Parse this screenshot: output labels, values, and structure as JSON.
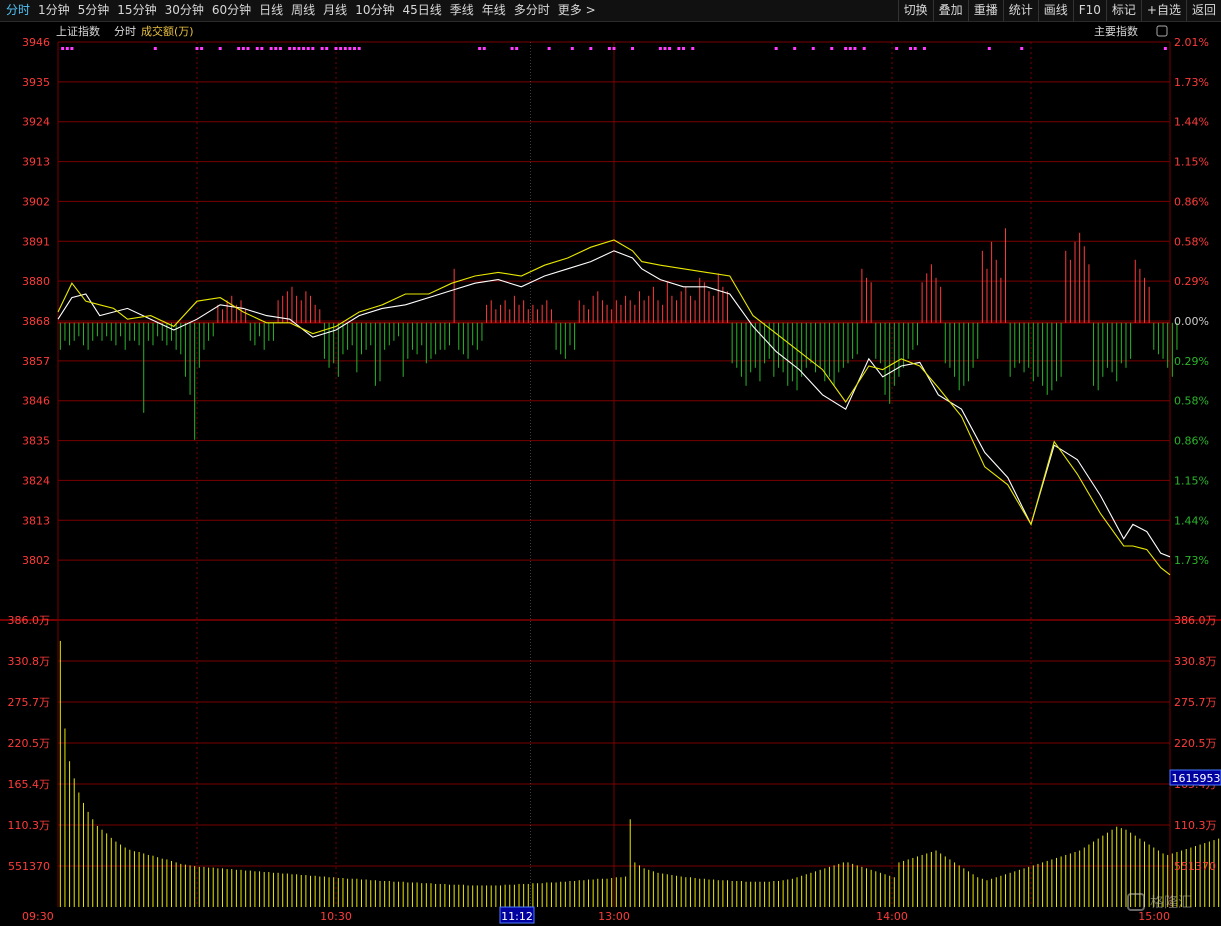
{
  "toolbar": {
    "left_items": [
      "分时",
      "1分钟",
      "5分钟",
      "15分钟",
      "30分钟",
      "60分钟",
      "日线",
      "周线",
      "月线",
      "10分钟",
      "45日线",
      "季线",
      "年线",
      "多分时",
      "更多 >"
    ],
    "active": "分时",
    "right_items": [
      "切换",
      "叠加",
      "重播",
      "统计",
      "画线",
      "F10",
      "标记",
      "+自选",
      "返回"
    ]
  },
  "header": {
    "index_name": "上证指数",
    "mode_label": "分时",
    "indicator_label": "成交额(万)",
    "right_label": "主要指数"
  },
  "colors": {
    "grid_red": "#7a0000",
    "up": "#ff3b3b",
    "down": "#2bb52b",
    "price_line": "#ffffff",
    "avg_line": "#e8e800",
    "marker": "#ff3cff",
    "axis_text_left": "#ff3b3b",
    "axis_text_vol": "#ff3b3b",
    "time_text": "#ff3b3b",
    "cursor_box": "#0000a0"
  },
  "cursor": {
    "time_label": "11:12",
    "volume_label": "1615953"
  },
  "watermark": "格隆汇",
  "chart_data": [
    {
      "type": "line",
      "title": "",
      "x_ticks": [
        "09:30",
        "10:30",
        "13:00",
        "14:00",
        "15:00"
      ],
      "y_ticks_left": [
        "3946",
        "3935",
        "3924",
        "3913",
        "3902",
        "3891",
        "3880",
        "3868",
        "3857",
        "3846",
        "3835",
        "3824",
        "3813",
        "3802"
      ],
      "y_ticks_right": [
        "2.01%",
        "1.73%",
        "1.44%",
        "1.15%",
        "0.86%",
        "0.58%",
        "0.29%",
        "0.00%",
        "0.29%",
        "0.58%",
        "0.86%",
        "1.15%",
        "1.44%",
        "1.73%"
      ],
      "ylim": [
        3791,
        3946
      ],
      "prev_close": 3868,
      "series": [
        {
          "role": "price",
          "x": [
            0,
            3,
            6,
            9,
            12,
            15,
            20,
            25,
            30,
            35,
            40,
            45,
            50,
            55,
            60,
            65,
            70,
            75,
            80,
            85,
            90,
            95,
            100,
            105,
            110,
            115,
            120,
            124,
            126,
            130,
            135,
            140,
            145,
            150,
            155,
            160,
            165,
            170,
            175,
            178,
            182,
            186,
            190,
            195,
            200,
            205,
            210,
            215,
            220,
            225,
            230,
            232,
            235,
            238,
            240
          ],
          "y": [
            3869,
            3875,
            3876,
            3870,
            3871,
            3872,
            3869,
            3866,
            3869,
            3873,
            3872,
            3870,
            3869,
            3864,
            3866,
            3870,
            3872,
            3873,
            3875,
            3877,
            3879,
            3880,
            3878,
            3881,
            3883,
            3885,
            3888,
            3886,
            3883,
            3880,
            3878,
            3878,
            3876,
            3867,
            3860,
            3855,
            3848,
            3844,
            3858,
            3853,
            3856,
            3857,
            3848,
            3844,
            3832,
            3825,
            3812,
            3834,
            3830,
            3820,
            3808,
            3812,
            3810,
            3804,
            3803
          ]
        },
        {
          "role": "average",
          "x": [
            0,
            3,
            6,
            9,
            12,
            15,
            20,
            25,
            30,
            35,
            40,
            45,
            50,
            55,
            60,
            65,
            70,
            75,
            80,
            85,
            90,
            95,
            100,
            105,
            110,
            115,
            120,
            124,
            126,
            130,
            135,
            140,
            145,
            150,
            155,
            160,
            165,
            170,
            175,
            178,
            182,
            186,
            190,
            195,
            200,
            205,
            210,
            215,
            220,
            225,
            230,
            232,
            235,
            238,
            240
          ],
          "y": [
            3871,
            3879,
            3874,
            3873,
            3872,
            3869,
            3870,
            3867,
            3874,
            3875,
            3871,
            3868,
            3868,
            3865,
            3867,
            3871,
            3873,
            3876,
            3876,
            3879,
            3881,
            3882,
            3881,
            3884,
            3886,
            3889,
            3891,
            3888,
            3885,
            3884,
            3883,
            3882,
            3881,
            3870,
            3865,
            3860,
            3855,
            3846,
            3856,
            3855,
            3858,
            3856,
            3850,
            3842,
            3828,
            3823,
            3812,
            3835,
            3826,
            3815,
            3806,
            3806,
            3805,
            3800,
            3798
          ]
        }
      ],
      "markers_x": [
        1,
        2,
        3,
        21,
        30,
        31,
        35,
        39,
        40,
        41,
        43,
        44,
        46,
        47,
        48,
        50,
        51,
        52,
        53,
        54,
        55,
        57,
        58,
        60,
        61,
        62,
        63,
        64,
        65,
        91,
        92,
        98,
        99,
        106,
        111,
        115,
        119,
        120,
        124,
        130,
        131,
        132,
        134,
        135,
        137,
        155,
        159,
        163,
        167,
        170,
        171,
        172,
        174,
        181,
        184,
        185,
        187,
        201,
        208,
        239
      ],
      "bars_amplitude": [
        -6,
        -4,
        -5,
        -4,
        -3,
        -5,
        -6,
        -4,
        -3,
        -4,
        -3,
        -4,
        -5,
        -3,
        -6,
        -4,
        -4,
        -5,
        -20,
        -4,
        -5,
        -3,
        -4,
        -5,
        -4,
        -6,
        -7,
        -12,
        -16,
        -26,
        -10,
        -6,
        -4,
        -3,
        4,
        3,
        5,
        6,
        4,
        5,
        3,
        -4,
        -5,
        -3,
        -6,
        -4,
        -4,
        5,
        6,
        7,
        8,
        6,
        5,
        7,
        6,
        4,
        3,
        -8,
        -10,
        -9,
        -12,
        -7,
        -6,
        -5,
        -11,
        -7,
        -6,
        -5,
        -14,
        -13,
        -6,
        -5,
        -4,
        -3,
        -12,
        -8,
        -6,
        -7,
        -5,
        -9,
        -8,
        -7,
        -6,
        -6,
        -5,
        12,
        -6,
        -7,
        -8,
        -5,
        -6,
        -4,
        4,
        5,
        3,
        4,
        5,
        3,
        6,
        4,
        5,
        3,
        4,
        3,
        4,
        5,
        3,
        -6,
        -7,
        -8,
        -5,
        -6,
        5,
        4,
        3,
        6,
        7,
        5,
        4,
        3,
        5,
        4,
        6,
        5,
        4,
        7,
        5,
        6,
        8,
        5,
        4,
        9,
        6,
        5,
        7,
        8,
        6,
        5,
        10,
        9,
        7,
        6,
        11,
        8,
        7,
        -9,
        -10,
        -12,
        -14,
        -11,
        -10,
        -13,
        -9,
        -8,
        -12,
        -10,
        -11,
        -14,
        -13,
        -15,
        -12,
        -10,
        -9,
        -11,
        -10,
        -13,
        -12,
        -14,
        -11,
        -10,
        -9,
        -8,
        -7,
        12,
        10,
        9,
        -8,
        -9,
        -16,
        -18,
        -14,
        -12,
        -10,
        -8,
        -6,
        -5,
        9,
        11,
        13,
        10,
        8,
        -9,
        -10,
        -12,
        -15,
        -14,
        -13,
        -10,
        -8,
        16,
        12,
        18,
        14,
        10,
        21,
        -12,
        -10,
        -9,
        -11,
        -10,
        -13,
        -12,
        -14,
        -16,
        -15,
        -13,
        -12,
        16,
        14,
        18,
        20,
        17,
        13,
        -14,
        -15,
        -12,
        -10,
        -11,
        -13,
        -9,
        -10,
        -8,
        14,
        12,
        10,
        8,
        -6,
        -7,
        -8,
        -10,
        -12,
        -6
      ],
      "bars_scale_note": ""
    },
    {
      "type": "bar",
      "title": "",
      "y_ticks_left": [
        "386.0万",
        "330.8万",
        "275.7万",
        "220.5万",
        "165.4万",
        "110.3万",
        "551370"
      ],
      "y_ticks_right": [
        "386.0万",
        "330.8万",
        "275.7万",
        "220.5万",
        "165.4万",
        "110.3万",
        "551370"
      ],
      "ylim": [
        0,
        386.0
      ],
      "unit": "万",
      "values": [
        358,
        240,
        196,
        173,
        154,
        140,
        128,
        118,
        109,
        104,
        99,
        93,
        88,
        84,
        80,
        77,
        75,
        74,
        72,
        70,
        69,
        67,
        65,
        64,
        62,
        60,
        58,
        57,
        56,
        55,
        54,
        54,
        53,
        53,
        52,
        52,
        51,
        51,
        50,
        50,
        49,
        49,
        48,
        48,
        47,
        47,
        46,
        46,
        45,
        45,
        44,
        44,
        43,
        43,
        42,
        42,
        41,
        41,
        40,
        40,
        39,
        39,
        38,
        38,
        38,
        37,
        37,
        36,
        36,
        35,
        35,
        35,
        34,
        34,
        34,
        33,
        33,
        33,
        32,
        32,
        32,
        31,
        31,
        31,
        30,
        30,
        30,
        30,
        29,
        29,
        29,
        29,
        29,
        29,
        29,
        29,
        30,
        30,
        30,
        31,
        31,
        31,
        32,
        32,
        32,
        33,
        33,
        33,
        34,
        34,
        35,
        35,
        36,
        36,
        37,
        37,
        38,
        38,
        38,
        39,
        40,
        40,
        41,
        118,
        60,
        56,
        52,
        50,
        48,
        46,
        45,
        44,
        43,
        42,
        41,
        40,
        40,
        39,
        38,
        38,
        37,
        37,
        36,
        36,
        36,
        35,
        35,
        35,
        34,
        34,
        34,
        34,
        34,
        34,
        35,
        35,
        36,
        37,
        38,
        40,
        42,
        44,
        46,
        48,
        50,
        52,
        54,
        56,
        58,
        60,
        60,
        58,
        56,
        54,
        52,
        50,
        48,
        46,
        44,
        42,
        40,
        60,
        62,
        64,
        66,
        68,
        70,
        72,
        74,
        76,
        72,
        68,
        64,
        60,
        56,
        52,
        48,
        44,
        40,
        38,
        36,
        38,
        40,
        42,
        44,
        46,
        48,
        50,
        52,
        54,
        56,
        58,
        60,
        62,
        64,
        66,
        68,
        70,
        72,
        74,
        76,
        80,
        84,
        88,
        92,
        96,
        100,
        104,
        108,
        106,
        104,
        100,
        96,
        92,
        88,
        84,
        80,
        76,
        72,
        70,
        72,
        74,
        76,
        78,
        80,
        82,
        84,
        86,
        88,
        90,
        92,
        94,
        96,
        98,
        100,
        102,
        104,
        98
      ]
    }
  ]
}
